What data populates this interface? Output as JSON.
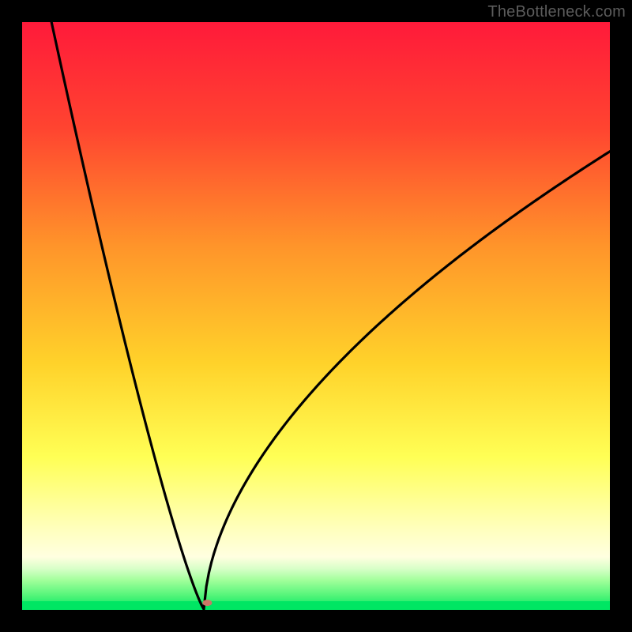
{
  "watermark": "TheBottleneck.com",
  "chart_data": {
    "type": "line",
    "title": "",
    "xlabel": "",
    "ylabel": "",
    "xlim": [
      0,
      100
    ],
    "ylim": [
      0,
      100
    ],
    "background_gradient": {
      "top_color": "#ff1a3a",
      "mid_colors": [
        "#ff7a2a",
        "#ffd22a",
        "#ffff55"
      ],
      "near_bottom_colors": [
        "#ffffbb",
        "#bfffbf"
      ],
      "bottom_color": "#00e663"
    },
    "curve": {
      "description": "V-shaped bottleneck curve with minimum at x≈31",
      "min_x": 31,
      "left_branch_start_y": 100,
      "left_branch_start_x": 5,
      "right_branch_end_y": 78,
      "right_branch_end_x": 100
    },
    "marker": {
      "x": 31.5,
      "y": 1.2,
      "color": "#cc7766",
      "rx": 6,
      "ry": 4
    }
  }
}
